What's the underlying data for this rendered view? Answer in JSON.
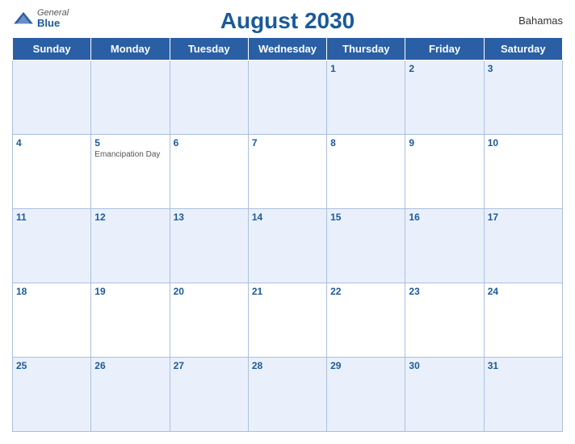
{
  "header": {
    "title": "August 2030",
    "country": "Bahamas",
    "logo_general": "General",
    "logo_blue": "Blue"
  },
  "days_of_week": [
    "Sunday",
    "Monday",
    "Tuesday",
    "Wednesday",
    "Thursday",
    "Friday",
    "Saturday"
  ],
  "weeks": [
    [
      {
        "day": "",
        "holiday": ""
      },
      {
        "day": "",
        "holiday": ""
      },
      {
        "day": "",
        "holiday": ""
      },
      {
        "day": "",
        "holiday": ""
      },
      {
        "day": "1",
        "holiday": ""
      },
      {
        "day": "2",
        "holiday": ""
      },
      {
        "day": "3",
        "holiday": ""
      }
    ],
    [
      {
        "day": "4",
        "holiday": ""
      },
      {
        "day": "5",
        "holiday": "Emancipation Day"
      },
      {
        "day": "6",
        "holiday": ""
      },
      {
        "day": "7",
        "holiday": ""
      },
      {
        "day": "8",
        "holiday": ""
      },
      {
        "day": "9",
        "holiday": ""
      },
      {
        "day": "10",
        "holiday": ""
      }
    ],
    [
      {
        "day": "11",
        "holiday": ""
      },
      {
        "day": "12",
        "holiday": ""
      },
      {
        "day": "13",
        "holiday": ""
      },
      {
        "day": "14",
        "holiday": ""
      },
      {
        "day": "15",
        "holiday": ""
      },
      {
        "day": "16",
        "holiday": ""
      },
      {
        "day": "17",
        "holiday": ""
      }
    ],
    [
      {
        "day": "18",
        "holiday": ""
      },
      {
        "day": "19",
        "holiday": ""
      },
      {
        "day": "20",
        "holiday": ""
      },
      {
        "day": "21",
        "holiday": ""
      },
      {
        "day": "22",
        "holiday": ""
      },
      {
        "day": "23",
        "holiday": ""
      },
      {
        "day": "24",
        "holiday": ""
      }
    ],
    [
      {
        "day": "25",
        "holiday": ""
      },
      {
        "day": "26",
        "holiday": ""
      },
      {
        "day": "27",
        "holiday": ""
      },
      {
        "day": "28",
        "holiday": ""
      },
      {
        "day": "29",
        "holiday": ""
      },
      {
        "day": "30",
        "holiday": ""
      },
      {
        "day": "31",
        "holiday": ""
      }
    ]
  ]
}
